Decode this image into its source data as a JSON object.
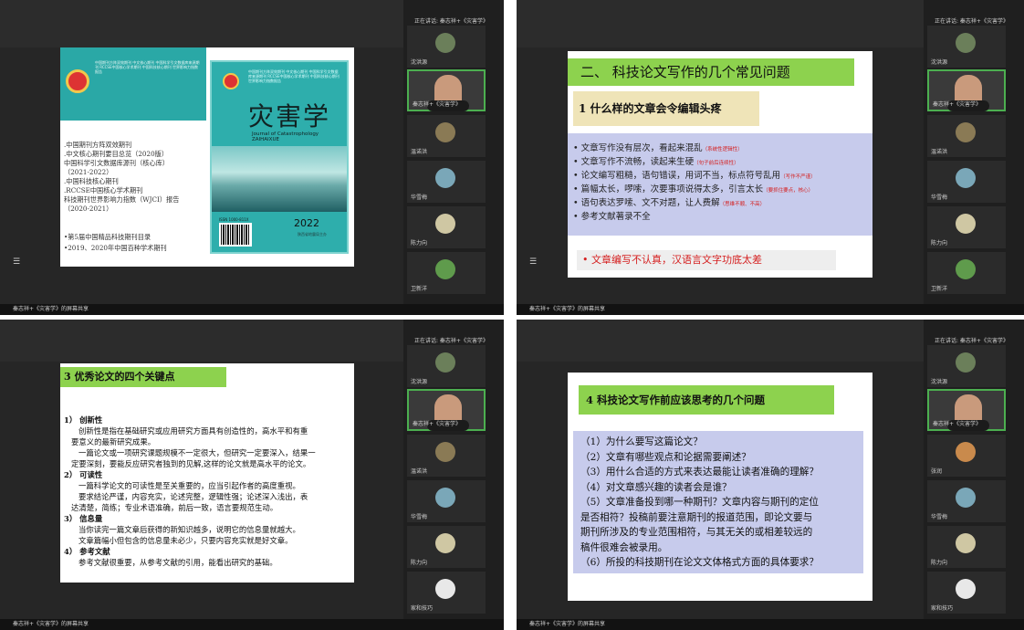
{
  "window_controls": [
    "-",
    "□",
    "×"
  ],
  "menu_icon": "☰",
  "share_caption": "秦志祥+《灾害学》的屏幕共享",
  "q1": {
    "speaker": "正在讲话: 秦志祥+《灾害学》",
    "participants": [
      "沈洪源",
      "秦志祥+《灾害学》",
      "温诺洪",
      "华雪梅",
      "陈力向",
      "卫新洋"
    ],
    "slide": {
      "cover_tiny_text": "中国期刊方阵双效期刊 中文核心期刊 中国科学引文数据库来源期刊 RCCSE中国核心学术期刊 中国科技核心期刊 世界影响力指数报告",
      "index_list": [
        ".中国期刊方阵双效期刊",
        ".中文核心期刊要目总览（2020版）",
        "中国科学引文数据库源刊（核心库）",
        "（2021-2022）",
        ".中国科技核心期刊",
        ".RCCSE中国核心学术期刊",
        "科技期刊世界影响力指数（WJCI）报告",
        "（2020-2021）"
      ],
      "index_list2": [
        "•第5届中国精品科技期刊目录",
        "•2019、2020年中国百种学术期刊"
      ],
      "cover_title": "灾害学",
      "cover_subtitle": "Journal of Catastrophology",
      "cover_subtitle2": "ZAIHAIXUE",
      "cover_year": "2022",
      "cover_pub": "陕西省地震局主办",
      "issn": "ISSN 1000-811X"
    }
  },
  "q2": {
    "speaker": "正在讲话: 秦志祥+《灾害学》",
    "participants": [
      "沈洪源",
      "秦志祥+《灾害学》",
      "温诺洪",
      "华雪梅",
      "陈力向",
      "卫新洋"
    ],
    "slide": {
      "title": "二、 科技论文写作的几个常见问题",
      "subtitle": "1 什么样的文章会令编辑头疼",
      "bullets": [
        {
          "text": "文章写作没有层次，看起来混乱",
          "note": "（系统性逻辑性）"
        },
        {
          "text": "文章写作不流畅，读起来生硬",
          "note": "（句子前后连续性）"
        },
        {
          "text": "论文编写粗糙，语句错误，用词不当，标点符号乱用",
          "note": "（写作不严谨）"
        },
        {
          "text": "篇幅太长，啰嗦，次要事项说得太多，引言太长",
          "note": "（要抓住要点，核心）"
        },
        {
          "text": "语句表达罗嗦、文不对题，让人费解",
          "note": "（思维不顺、不高）"
        },
        {
          "text": "参考文献著录不全",
          "note": ""
        }
      ],
      "conclusion": "• 文章编写不认真，汉语言文字功底太差"
    }
  },
  "q3": {
    "speaker": "正在讲话: 秦志祥+《灾害学》",
    "participants": [
      "沈洪源",
      "秦志祥+《灾害学》",
      "温诺洪",
      "华雪梅",
      "陈力向",
      "家和技巧"
    ],
    "slide": {
      "title": "3 优秀论文的四个关键点",
      "lines": [
        {
          "t": "1） 创新性",
          "h": true,
          "i": 0
        },
        {
          "t": "创新性是指在基础研究或应用研究方面具有创造性的，高水平和有重",
          "h": false,
          "i": 2
        },
        {
          "t": "要意义的最新研究成果。",
          "h": false,
          "i": 1
        },
        {
          "t": "一篇论文或一项研究课题规模不一定很大，但研究一定要深入，结果一",
          "h": false,
          "i": 2
        },
        {
          "t": "定要深刻，要能反应研究者独到的见解,这样的论文就是高水平的论文。",
          "h": false,
          "i": 1
        },
        {
          "t": "2） 可读性",
          "h": true,
          "i": 0
        },
        {
          "t": "一篇科学论文的可读性是至关重要的，应当引起作者的高度重视。",
          "h": false,
          "i": 2
        },
        {
          "t": "要求结论严谨，内容充实，论述完整，逻辑性强；论述深入浅出，表",
          "h": false,
          "i": 2
        },
        {
          "t": "达清楚，简练；专业术语准确，前后一致，语言要规范生动。",
          "h": false,
          "i": 1
        },
        {
          "t": "3） 信息量",
          "h": true,
          "i": 0
        },
        {
          "t": "当你读完一篇文章后获得的新知识越多，说明它的信息量就越大。",
          "h": false,
          "i": 2
        },
        {
          "t": "文章篇幅小但包含的信息量未必少，只要内容充实就是好文章。",
          "h": false,
          "i": 2
        },
        {
          "t": "4） 参考文献",
          "h": true,
          "i": 0
        },
        {
          "t": "参考文献很重要，从参考文献的引用，能看出研究的基础。",
          "h": false,
          "i": 2
        }
      ]
    }
  },
  "q4": {
    "speaker": "正在讲话: 秦志祥+《灾害学》",
    "participants": [
      "沈洪源",
      "秦志祥+《灾害学》",
      "张润",
      "华雪梅",
      "陈力向",
      "家和技巧"
    ],
    "slide": {
      "title": "4 科技论文写作前应该思考的几个问题",
      "items": [
        "（1）为什么要写这篇论文？",
        "（2）文章有哪些观点和论据需要阐述？",
        "（3）用什么合适的方式来表达最能让读者准确的理解？",
        "（4）对文章感兴趣的读者会是谁？",
        "（5）文章准备投到哪一种期刊？文章内容与期刊的定位",
        "是否相符？投稿前要注意期刊的报道范围，即论文要与",
        "期刊所涉及的专业范围相符，与其无关的或相差较远的",
        "稿件很难会被录用。",
        "（6）所投的科技期刊在论文文体格式方面的具体要求？"
      ]
    }
  },
  "colors": {
    "teal": "#2aa8a6",
    "green_header": "#8dd24e",
    "tan_header": "#efe4b8",
    "blue_box": "#c7cbec",
    "red_text": "#d52020"
  }
}
